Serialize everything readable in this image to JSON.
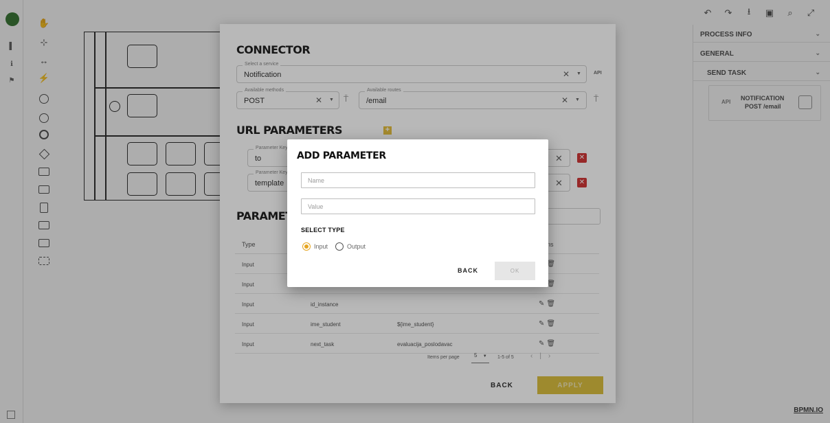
{
  "rail": {
    "items": [
      "▌",
      "ℹ",
      "⚑"
    ]
  },
  "top_toolbar": {
    "icons": [
      "undo-icon",
      "redo-icon",
      "download-icon",
      "save-icon",
      "search-icon",
      "fullscreen-icon"
    ]
  },
  "right_panel": {
    "process_info": "PROCESS INFO",
    "general": "GENERAL",
    "send_task": "SEND TASK",
    "card_api": "API",
    "card_line1": "NOTIFICATION",
    "card_line2": "POST /email"
  },
  "bpmn_io": "BPMN.IO",
  "connector": {
    "title": "CONNECTOR",
    "service": {
      "label": "Select a service",
      "value": "Notification",
      "api_tag": "API"
    },
    "methods": {
      "label": "Available methods",
      "value": "POST"
    },
    "routes": {
      "label": "Available routes",
      "value": "/email"
    },
    "url_params_title": "URL PARAMETERS",
    "url_params": [
      {
        "key_label": "Parameter Key",
        "key": "to"
      },
      {
        "key_label": "Parameter Key",
        "key": "template"
      }
    ],
    "params_title": "PARAMETERS",
    "table": {
      "headers": {
        "type": "Type",
        "actions": "Actions"
      },
      "rows": [
        {
          "type": "Input",
          "name": "",
          "value": ""
        },
        {
          "type": "Input",
          "name": "",
          "value": ""
        },
        {
          "type": "Input",
          "name": "id_instance",
          "value": ""
        },
        {
          "type": "Input",
          "name": "ime_student",
          "value": "${ime_student}"
        },
        {
          "type": "Input",
          "name": "next_task",
          "value": "evaluacija_poslodavac"
        }
      ]
    },
    "pager": {
      "label": "Items per page",
      "per_page": "5",
      "range": "1-5 of 5"
    },
    "back_label": "BACK",
    "apply_label": "APPLY"
  },
  "modal": {
    "title": "ADD PARAMETER",
    "name_placeholder": "Name",
    "value_placeholder": "Value",
    "select_type": "SELECT TYPE",
    "options": [
      "Input",
      "Output"
    ],
    "selected": "Input",
    "back_label": "BACK",
    "ok_label": "OK"
  },
  "colors": {
    "accent": "#e6a520",
    "apply": "#dcc040",
    "delete": "#d23838"
  }
}
